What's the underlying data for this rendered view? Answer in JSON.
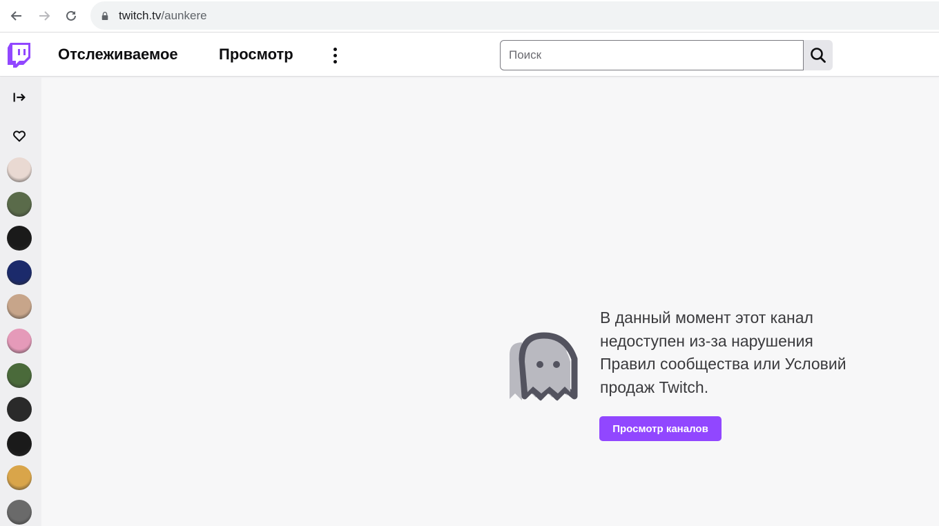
{
  "browser": {
    "url_host": "twitch.tv",
    "url_path": "/aunkere"
  },
  "topnav": {
    "following_label": "Отслеживаемое",
    "browse_label": "Просмотр",
    "search_placeholder": "Поиск"
  },
  "sidebar": {
    "avatars": [
      {
        "name": "followed-channel-1",
        "color": "#e9d9d2"
      },
      {
        "name": "followed-channel-2",
        "color": "#5a6b4a"
      },
      {
        "name": "followed-channel-3",
        "color": "#1a1a1a"
      },
      {
        "name": "followed-channel-4",
        "color": "#1b2a6b"
      },
      {
        "name": "followed-channel-5",
        "color": "#c7a58a"
      },
      {
        "name": "followed-channel-6",
        "color": "#e59ab9"
      },
      {
        "name": "followed-channel-7",
        "color": "#4a6a3a"
      },
      {
        "name": "followed-channel-8",
        "color": "#2a2a2a"
      },
      {
        "name": "followed-channel-9",
        "color": "#1a1a1a"
      },
      {
        "name": "followed-channel-10",
        "color": "#d9a54a"
      },
      {
        "name": "followed-channel-11",
        "color": "#6a6a6a"
      }
    ]
  },
  "main": {
    "message": "В данный момент этот канал недоступен из-за нарушения Правил сообщества или Условий продаж Twitch.",
    "browse_channels_label": "Просмотр каналов"
  },
  "colors": {
    "accent": "#9147ff",
    "text": "#0e0e10"
  }
}
